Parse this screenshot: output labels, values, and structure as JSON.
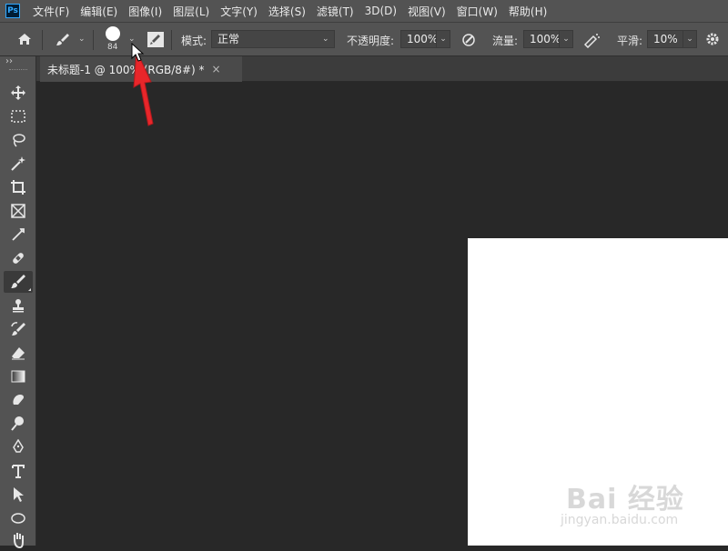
{
  "app": {
    "logo_text": "Ps"
  },
  "menu": [
    "文件(F)",
    "编辑(E)",
    "图像(I)",
    "图层(L)",
    "文字(Y)",
    "选择(S)",
    "滤镜(T)",
    "3D(D)",
    "视图(V)",
    "窗口(W)",
    "帮助(H)"
  ],
  "options": {
    "brush_size": "84",
    "mode_label": "模式:",
    "mode_value": "正常",
    "opacity_label": "不透明度:",
    "opacity_value": "100%",
    "flow_label": "流量:",
    "flow_value": "100%",
    "smooth_label": "平滑:",
    "smooth_value": "10%"
  },
  "toolbar": {
    "collapse_glyph": "››"
  },
  "document_tab": {
    "title": "未标题-1 @ 100% (RGB/8#) *",
    "close": "×"
  },
  "watermark": {
    "main": "Bai 经验",
    "sub": "jingyan.baidu.com"
  },
  "colors": {
    "annotation_arrow": "#e8262a",
    "canvas_bg": "#282828",
    "panel_bg": "#535353"
  }
}
